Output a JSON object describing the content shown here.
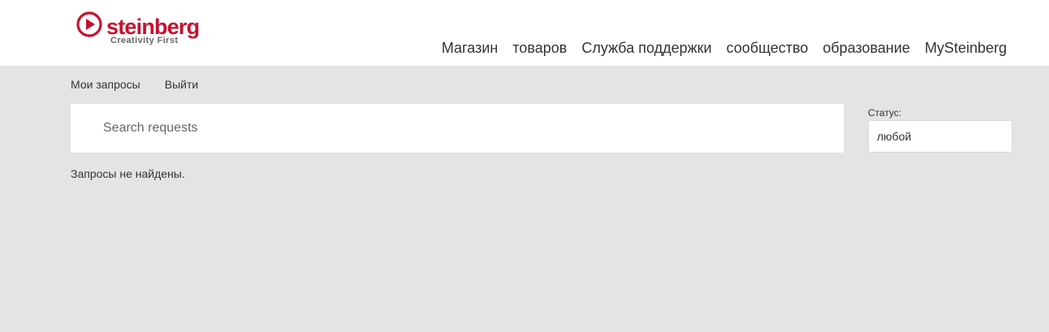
{
  "brand": {
    "name": "steinberg",
    "tagline": "Creativity First",
    "color": "#c8102e"
  },
  "main_nav": {
    "items": [
      {
        "label": "Магазин"
      },
      {
        "label": "товаров"
      },
      {
        "label": "Служба поддержки"
      },
      {
        "label": "сообщество"
      },
      {
        "label": "образование"
      },
      {
        "label": "MySteinberg"
      }
    ]
  },
  "sub_nav": {
    "my_requests": "Мои запросы",
    "logout": "Выйти"
  },
  "search": {
    "placeholder": "Search requests",
    "value": ""
  },
  "status_filter": {
    "label": "Статус:",
    "selected": "любой"
  },
  "results": {
    "empty_message": "Запросы не найдены."
  }
}
